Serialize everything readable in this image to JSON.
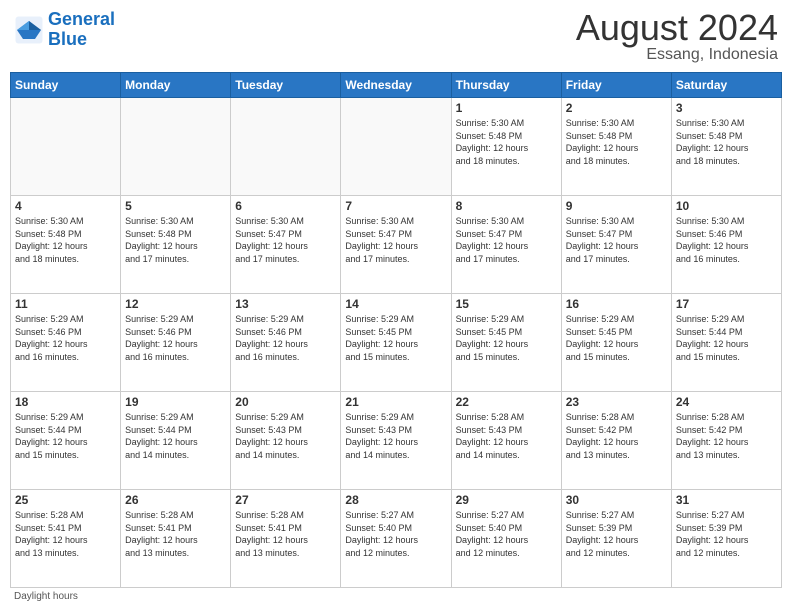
{
  "header": {
    "logo_line1": "General",
    "logo_line2": "Blue",
    "main_title": "August 2024",
    "sub_title": "Essang, Indonesia"
  },
  "calendar": {
    "days_of_week": [
      "Sunday",
      "Monday",
      "Tuesday",
      "Wednesday",
      "Thursday",
      "Friday",
      "Saturday"
    ],
    "weeks": [
      [
        {
          "day": "",
          "info": ""
        },
        {
          "day": "",
          "info": ""
        },
        {
          "day": "",
          "info": ""
        },
        {
          "day": "",
          "info": ""
        },
        {
          "day": "1",
          "info": "Sunrise: 5:30 AM\nSunset: 5:48 PM\nDaylight: 12 hours\nand 18 minutes."
        },
        {
          "day": "2",
          "info": "Sunrise: 5:30 AM\nSunset: 5:48 PM\nDaylight: 12 hours\nand 18 minutes."
        },
        {
          "day": "3",
          "info": "Sunrise: 5:30 AM\nSunset: 5:48 PM\nDaylight: 12 hours\nand 18 minutes."
        }
      ],
      [
        {
          "day": "4",
          "info": "Sunrise: 5:30 AM\nSunset: 5:48 PM\nDaylight: 12 hours\nand 18 minutes."
        },
        {
          "day": "5",
          "info": "Sunrise: 5:30 AM\nSunset: 5:48 PM\nDaylight: 12 hours\nand 17 minutes."
        },
        {
          "day": "6",
          "info": "Sunrise: 5:30 AM\nSunset: 5:47 PM\nDaylight: 12 hours\nand 17 minutes."
        },
        {
          "day": "7",
          "info": "Sunrise: 5:30 AM\nSunset: 5:47 PM\nDaylight: 12 hours\nand 17 minutes."
        },
        {
          "day": "8",
          "info": "Sunrise: 5:30 AM\nSunset: 5:47 PM\nDaylight: 12 hours\nand 17 minutes."
        },
        {
          "day": "9",
          "info": "Sunrise: 5:30 AM\nSunset: 5:47 PM\nDaylight: 12 hours\nand 17 minutes."
        },
        {
          "day": "10",
          "info": "Sunrise: 5:30 AM\nSunset: 5:46 PM\nDaylight: 12 hours\nand 16 minutes."
        }
      ],
      [
        {
          "day": "11",
          "info": "Sunrise: 5:29 AM\nSunset: 5:46 PM\nDaylight: 12 hours\nand 16 minutes."
        },
        {
          "day": "12",
          "info": "Sunrise: 5:29 AM\nSunset: 5:46 PM\nDaylight: 12 hours\nand 16 minutes."
        },
        {
          "day": "13",
          "info": "Sunrise: 5:29 AM\nSunset: 5:46 PM\nDaylight: 12 hours\nand 16 minutes."
        },
        {
          "day": "14",
          "info": "Sunrise: 5:29 AM\nSunset: 5:45 PM\nDaylight: 12 hours\nand 15 minutes."
        },
        {
          "day": "15",
          "info": "Sunrise: 5:29 AM\nSunset: 5:45 PM\nDaylight: 12 hours\nand 15 minutes."
        },
        {
          "day": "16",
          "info": "Sunrise: 5:29 AM\nSunset: 5:45 PM\nDaylight: 12 hours\nand 15 minutes."
        },
        {
          "day": "17",
          "info": "Sunrise: 5:29 AM\nSunset: 5:44 PM\nDaylight: 12 hours\nand 15 minutes."
        }
      ],
      [
        {
          "day": "18",
          "info": "Sunrise: 5:29 AM\nSunset: 5:44 PM\nDaylight: 12 hours\nand 15 minutes."
        },
        {
          "day": "19",
          "info": "Sunrise: 5:29 AM\nSunset: 5:44 PM\nDaylight: 12 hours\nand 14 minutes."
        },
        {
          "day": "20",
          "info": "Sunrise: 5:29 AM\nSunset: 5:43 PM\nDaylight: 12 hours\nand 14 minutes."
        },
        {
          "day": "21",
          "info": "Sunrise: 5:29 AM\nSunset: 5:43 PM\nDaylight: 12 hours\nand 14 minutes."
        },
        {
          "day": "22",
          "info": "Sunrise: 5:28 AM\nSunset: 5:43 PM\nDaylight: 12 hours\nand 14 minutes."
        },
        {
          "day": "23",
          "info": "Sunrise: 5:28 AM\nSunset: 5:42 PM\nDaylight: 12 hours\nand 13 minutes."
        },
        {
          "day": "24",
          "info": "Sunrise: 5:28 AM\nSunset: 5:42 PM\nDaylight: 12 hours\nand 13 minutes."
        }
      ],
      [
        {
          "day": "25",
          "info": "Sunrise: 5:28 AM\nSunset: 5:41 PM\nDaylight: 12 hours\nand 13 minutes."
        },
        {
          "day": "26",
          "info": "Sunrise: 5:28 AM\nSunset: 5:41 PM\nDaylight: 12 hours\nand 13 minutes."
        },
        {
          "day": "27",
          "info": "Sunrise: 5:28 AM\nSunset: 5:41 PM\nDaylight: 12 hours\nand 13 minutes."
        },
        {
          "day": "28",
          "info": "Sunrise: 5:27 AM\nSunset: 5:40 PM\nDaylight: 12 hours\nand 12 minutes."
        },
        {
          "day": "29",
          "info": "Sunrise: 5:27 AM\nSunset: 5:40 PM\nDaylight: 12 hours\nand 12 minutes."
        },
        {
          "day": "30",
          "info": "Sunrise: 5:27 AM\nSunset: 5:39 PM\nDaylight: 12 hours\nand 12 minutes."
        },
        {
          "day": "31",
          "info": "Sunrise: 5:27 AM\nSunset: 5:39 PM\nDaylight: 12 hours\nand 12 minutes."
        }
      ]
    ]
  },
  "footer": {
    "note": "Daylight hours"
  }
}
